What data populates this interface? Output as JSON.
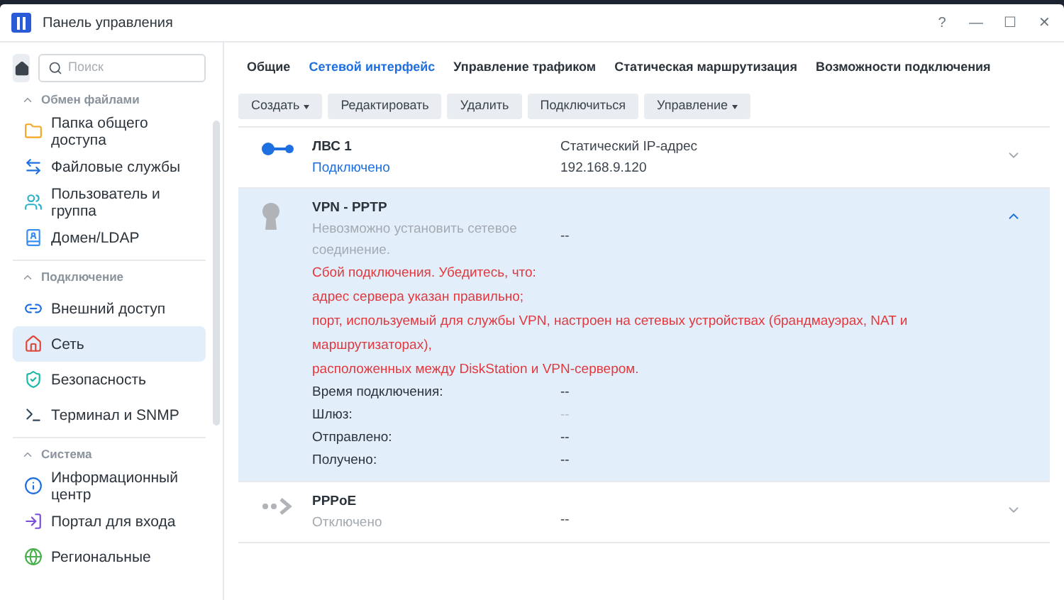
{
  "window": {
    "title": "Панель управления",
    "controls": [
      "?",
      "—",
      "☐",
      "✕"
    ]
  },
  "search": {
    "placeholder": "Поиск"
  },
  "sidebar": {
    "sections": [
      {
        "label": "Обмен файлами",
        "expanded": true,
        "items": [
          {
            "label": "Папка общего доступа",
            "selected": false
          },
          {
            "label": "Файловые службы",
            "selected": false
          },
          {
            "label": "Пользователь и группа",
            "selected": false
          },
          {
            "label": "Домен/LDAP",
            "selected": false
          }
        ]
      },
      {
        "label": "Подключение",
        "expanded": true,
        "items": [
          {
            "label": "Внешний доступ",
            "selected": false
          },
          {
            "label": "Сеть",
            "selected": true
          },
          {
            "label": "Безопасность",
            "selected": false
          },
          {
            "label": "Терминал и SNMP",
            "selected": false
          }
        ]
      },
      {
        "label": "Система",
        "expanded": true,
        "items": [
          {
            "label": "Информационный центр",
            "selected": false
          },
          {
            "label": "Портал для входа",
            "selected": false
          },
          {
            "label": "Региональные",
            "selected": false
          }
        ]
      }
    ]
  },
  "tabs": [
    {
      "label": "Общие",
      "selected": false
    },
    {
      "label": "Сетевой интерфейс",
      "selected": true
    },
    {
      "label": "Управление трафиком",
      "selected": false
    },
    {
      "label": "Статическая маршрутизация",
      "selected": false
    },
    {
      "label": "Возможности подключения",
      "selected": false
    }
  ],
  "toolbar": [
    {
      "label": "Создать",
      "dropdown": true
    },
    {
      "label": "Редактировать",
      "dropdown": false
    },
    {
      "label": "Удалить",
      "dropdown": false
    },
    {
      "label": "Подключиться",
      "dropdown": false
    },
    {
      "label": "Управление",
      "dropdown": true
    }
  ],
  "interfaces": [
    {
      "kind": "lan",
      "name": "ЛВС 1",
      "status": "Подключено",
      "connected": true,
      "expanded": false,
      "detail": [
        "Статический IP-адрес",
        "192.168.9.120"
      ]
    },
    {
      "kind": "vpn",
      "name": "VPN - PPTP",
      "status": "Невозможно установить сетевое соединение.",
      "connected": false,
      "expanded": true,
      "detail": [
        "--"
      ],
      "errors": [
        "Сбой подключения. Убедитесь, что:",
        "адрес сервера указан правильно;",
        "порт, используемый для службы VPN, настроен на сетевых устройствах (брандмауэрах, NAT и маршрутизаторах),",
        "расположенных между DiskStation и VPN-сервером."
      ],
      "fields": [
        {
          "label": "Время подключения:",
          "value": "--",
          "disabled": false
        },
        {
          "label": "Шлюз:",
          "value": "--",
          "disabled": true
        },
        {
          "label": "Отправлено:",
          "value": "--",
          "disabled": false
        },
        {
          "label": "Получено:",
          "value": "--",
          "disabled": false
        }
      ]
    },
    {
      "kind": "pppoe",
      "name": "PPPoE",
      "status": "Отключено",
      "connected": false,
      "expanded": false,
      "detail": [
        "--"
      ]
    }
  ]
}
